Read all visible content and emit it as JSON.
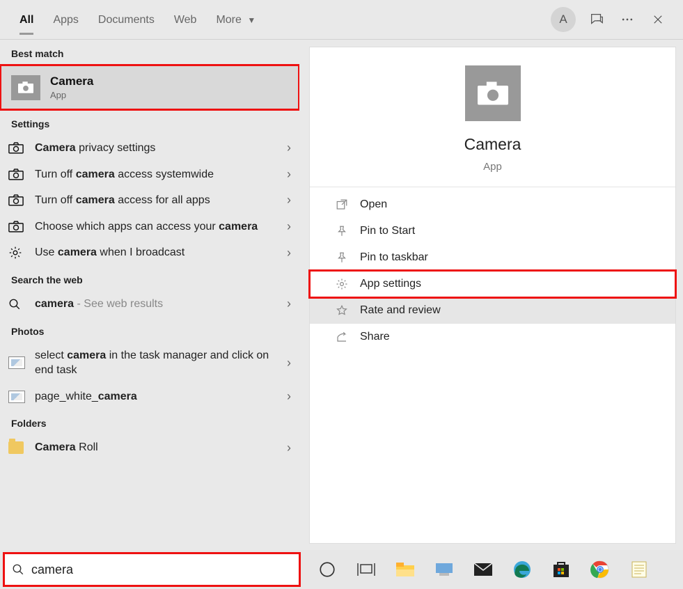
{
  "tabs": {
    "all": "All",
    "apps": "Apps",
    "documents": "Documents",
    "web": "Web",
    "more": "More"
  },
  "avatar_initial": "A",
  "sections": {
    "best_match": "Best match",
    "settings": "Settings",
    "search_web": "Search the web",
    "photos": "Photos",
    "folders": "Folders"
  },
  "best_match_result": {
    "title": "Camera",
    "kind": "App"
  },
  "settings_results": [
    {
      "bold1": "Camera",
      "rest": " privacy settings"
    },
    {
      "pre": "Turn off ",
      "bold1": "camera",
      "rest": " access systemwide"
    },
    {
      "pre": "Turn off ",
      "bold1": "camera",
      "rest": " access for all apps"
    },
    {
      "pre": "Choose which apps can access your ",
      "bold_end": "camera"
    },
    {
      "pre": "Use ",
      "bold1": "camera",
      "rest": " when I broadcast"
    }
  ],
  "web_result": {
    "bold": "camera",
    "tail": "See web results"
  },
  "photos_results": [
    {
      "pre": "select ",
      "bold1": "camera",
      "rest": " in the task manager and click on end task"
    },
    {
      "pre": "page_white_",
      "bold1": "camera"
    }
  ],
  "folder_result": {
    "bold": "Camera",
    "rest": " Roll"
  },
  "preview": {
    "title": "Camera",
    "kind": "App"
  },
  "actions": {
    "open": "Open",
    "pin_start": "Pin to Start",
    "pin_taskbar": "Pin to taskbar",
    "app_settings": "App settings",
    "rate": "Rate and review",
    "share": "Share"
  },
  "search_value": "camera"
}
